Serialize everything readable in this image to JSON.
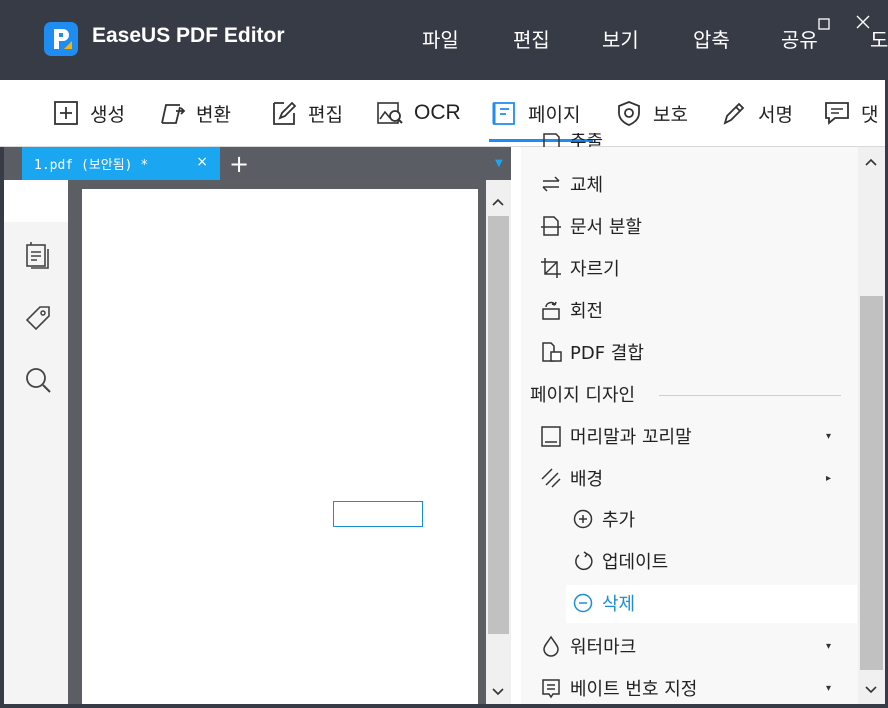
{
  "app": {
    "title": "EaseUS PDF Editor"
  },
  "menu": [
    "파일",
    "편집",
    "보기",
    "압축",
    "공유",
    "도"
  ],
  "toolbar": [
    {
      "label": "생성",
      "icon": "plus-square-icon"
    },
    {
      "label": "변환",
      "icon": "convert-icon"
    },
    {
      "label": "편집",
      "icon": "edit-icon"
    },
    {
      "label": "OCR",
      "icon": "ocr-icon"
    },
    {
      "label": "페이지",
      "icon": "page-icon",
      "active": true
    },
    {
      "label": "보호",
      "icon": "shield-icon"
    },
    {
      "label": "서명",
      "icon": "pen-icon"
    },
    {
      "label": "댓",
      "icon": "comment-icon"
    }
  ],
  "tabs": {
    "doc_tab_label": "1.pdf (보안됨) *",
    "close": "×",
    "add": "+"
  },
  "sidebar_icons": [
    "pages-icon",
    "tag-icon",
    "search-icon"
  ],
  "panel": {
    "partial_top": "추출",
    "items": [
      {
        "label": "교체",
        "icon": "swap-icon"
      },
      {
        "label": "문서 분할",
        "icon": "split-icon"
      },
      {
        "label": "자르기",
        "icon": "crop-icon"
      },
      {
        "label": "회전",
        "icon": "rotate-icon"
      },
      {
        "label": "PDF 결합",
        "icon": "combine-icon"
      }
    ],
    "section_title": "페이지 디자인",
    "design_items": [
      {
        "label": "머리말과 꼬리말",
        "icon": "header-footer-icon",
        "arrow": "▾"
      },
      {
        "label": "배경",
        "icon": "background-icon",
        "arrow": "▸"
      }
    ],
    "background_sub": [
      {
        "label": "추가",
        "icon": "add-circle-icon"
      },
      {
        "label": "업데이트",
        "icon": "refresh-icon"
      },
      {
        "label": "삭제",
        "icon": "remove-circle-icon",
        "highlight": true
      }
    ],
    "more_items": [
      {
        "label": "워터마크",
        "icon": "drop-icon",
        "arrow": "▾"
      },
      {
        "label": "베이트 번호 지정",
        "icon": "numbering-icon",
        "arrow": "▾"
      }
    ]
  },
  "colors": {
    "titlebar": "#363b45",
    "accent": "#1e8cf0",
    "tab": "#1aa6f0",
    "highlight_text": "#1a8fd6"
  }
}
